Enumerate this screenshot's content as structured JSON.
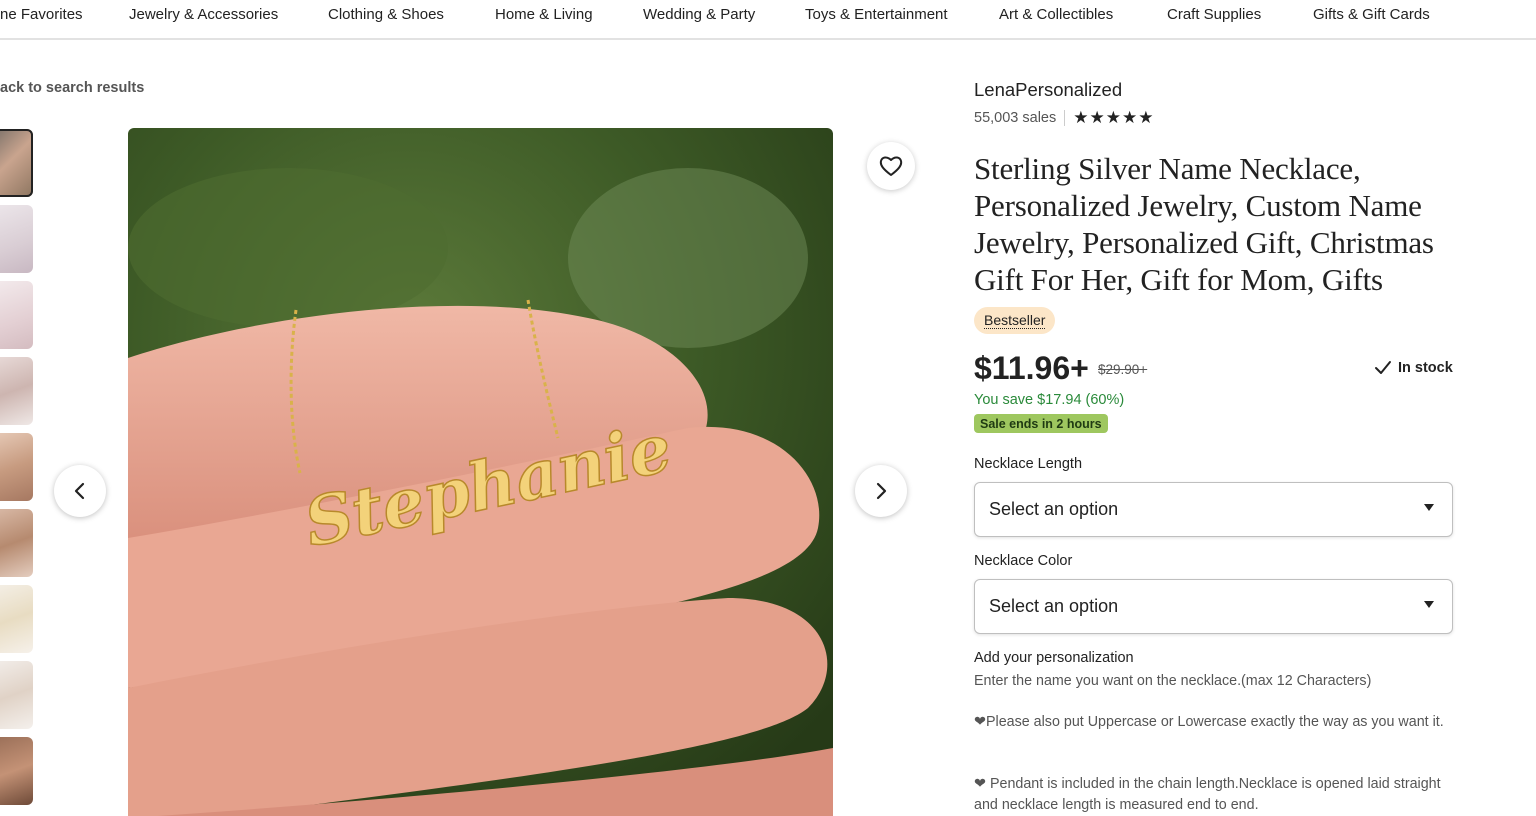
{
  "nav": {
    "items": [
      "ne Favorites",
      "Jewelry & Accessories",
      "Clothing & Shoes",
      "Home & Living",
      "Wedding & Party",
      "Toys & Entertainment",
      "Art & Collectibles",
      "Craft Supplies",
      "Gifts & Gift Cards"
    ]
  },
  "back_link": "ack to search results",
  "gallery": {
    "thumbnail_count": 9,
    "active_index": 0,
    "main_image_text": "Stephanie"
  },
  "shop": {
    "name": "LenaPersonalized",
    "sales": "55,003 sales",
    "rating": 5
  },
  "listing": {
    "title": "Sterling Silver Name Necklace, Personalized Jewelry, Custom Name Jewelry, Personalized Gift, Christmas Gift For Her, Gift for Mom, Gifts",
    "badge": "Bestseller",
    "price": "$11.96+",
    "original_price": "$29.90+",
    "stock": "In stock",
    "savings": "You save $17.94 (60%)",
    "sale_note": "Sale ends in 2 hours"
  },
  "options": {
    "length_label": "Necklace Length",
    "length_value": "Select an option",
    "color_label": "Necklace Color",
    "color_value": "Select an option"
  },
  "personalization": {
    "label": "Add your personalization",
    "line1": "Enter the name you want on the necklace.(max 12 Characters)",
    "line2": "❤Please also put Uppercase or Lowercase exactly the way as you want it.",
    "line3": "❤ Pendant is included in the chain length.Necklace is opened laid straight and necklace length is measured end to end."
  },
  "colors": {
    "badge_bg": "#fce6c8",
    "savings_text": "#2a8a3a",
    "sale_pill_bg": "#9ec75f"
  }
}
